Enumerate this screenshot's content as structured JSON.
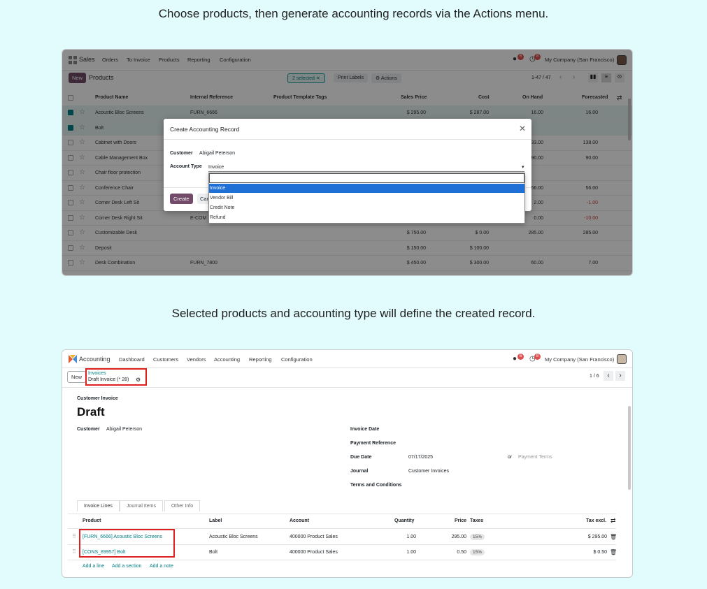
{
  "captions": {
    "top": "Choose products, then generate accounting records via the Actions menu.",
    "bottom": "Selected products and accounting type will define the created record."
  },
  "sales": {
    "app": "Sales",
    "menu": [
      "Orders",
      "To Invoice",
      "Products",
      "Reporting",
      "Configuration"
    ],
    "company": "My Company (San Francisco)",
    "badge_a": "6",
    "badge_b": "8",
    "new_label": "New",
    "page_title": "Products",
    "selected_label": "2 selected",
    "print_labels": "Print Labels",
    "actions": "Actions",
    "pager": "1-47 / 47",
    "columns": [
      "Product Name",
      "Internal Reference",
      "Product Template Tags",
      "Sales Price",
      "Cost",
      "On Hand",
      "Forecasted"
    ],
    "rows": [
      {
        "name": "Acoustic Bloc Screens",
        "ref": "FURN_6666",
        "price": "$ 295.00",
        "cost": "$ 287.00",
        "onhand": "16.00",
        "forecast": "16.00"
      },
      {
        "name": "Bolt",
        "ref": "",
        "price": "",
        "cost": "",
        "onhand": "",
        "forecast": ""
      },
      {
        "name": "Cabinet with Doors",
        "ref": "",
        "price": "",
        "cost": "",
        "onhand": "133.00",
        "forecast": "138.00"
      },
      {
        "name": "Cable Management Box",
        "ref": "",
        "price": "",
        "cost": "",
        "onhand": "90.00",
        "forecast": "90.00"
      },
      {
        "name": "Chair floor protection",
        "ref": "",
        "price": "",
        "cost": "",
        "onhand": "",
        "forecast": ""
      },
      {
        "name": "Conference Chair",
        "ref": "",
        "price": "",
        "cost": "",
        "onhand": "56.00",
        "forecast": "56.00"
      },
      {
        "name": "Corner Desk Left Sit",
        "ref": "",
        "price": "",
        "cost": "",
        "onhand": "2.00",
        "forecast": "-1.00"
      },
      {
        "name": "Corner Desk Right Sit",
        "ref": "E-COM",
        "price": "",
        "cost": "",
        "onhand": "0.00",
        "forecast": "-10.00"
      },
      {
        "name": "Customizable Desk",
        "ref": "",
        "price": "$ 750.00",
        "cost": "$ 0.00",
        "onhand": "285.00",
        "forecast": "285.00"
      },
      {
        "name": "Deposit",
        "ref": "",
        "price": "$ 150.00",
        "cost": "$ 100.00",
        "onhand": "",
        "forecast": ""
      },
      {
        "name": "Desk Combination",
        "ref": "FURN_7800",
        "price": "$ 450.00",
        "cost": "$ 300.00",
        "onhand": "60.00",
        "forecast": "7.00"
      }
    ]
  },
  "modal": {
    "title": "Create Accounting Record",
    "customer_label": "Customer",
    "customer_value": "Abigail Peterson",
    "type_label": "Account Type",
    "type_value": "Invoice",
    "create": "Create",
    "cancel_partial": "Can",
    "options": [
      "Invoice",
      "Vendor Bill",
      "Credit Note",
      "Refund"
    ]
  },
  "accounting": {
    "app": "Accounting",
    "menu": [
      "Dashboard",
      "Customers",
      "Vendors",
      "Accounting",
      "Reporting",
      "Configuration"
    ],
    "company": "My Company (San Francisco)",
    "badge_a": "6",
    "badge_b": "8",
    "new_label": "New",
    "breadcrumb_parent": "Invoices",
    "breadcrumb_current": "Draft Invoice (* 28)",
    "pager": "1 / 6",
    "doc_type": "Customer Invoice",
    "status": "Draft",
    "customer_label": "Customer",
    "customer_value": "Abigail Peterson",
    "invoice_date_label": "Invoice Date",
    "payment_ref_label": "Payment Reference",
    "due_date_label": "Due Date",
    "due_date_value": "07/17/2025",
    "or": "or",
    "payment_terms_placeholder": "Payment Terms",
    "journal_label": "Journal",
    "journal_value": "Customer Invoices",
    "terms_label": "Terms and Conditions",
    "tabs": [
      "Invoice Lines",
      "Journal Items",
      "Other Info"
    ],
    "columns": [
      "Product",
      "Label",
      "Account",
      "Quantity",
      "Price",
      "Taxes",
      "Tax excl."
    ],
    "lines": [
      {
        "product": "[FURN_6666] Acoustic Bloc Screens",
        "label": "Acoustic Bloc Screens",
        "account": "400000 Product Sales",
        "qty": "1.00",
        "price": "295.00",
        "tax": "15%",
        "subtotal": "$ 295.00"
      },
      {
        "product": "[CONS_89957] Bolt",
        "label": "Bolt",
        "account": "400000 Product Sales",
        "qty": "1.00",
        "price": "0.50",
        "tax": "15%",
        "subtotal": "$ 0.50"
      }
    ],
    "add_line": "Add a line",
    "add_section": "Add a section",
    "add_note": "Add a note"
  }
}
